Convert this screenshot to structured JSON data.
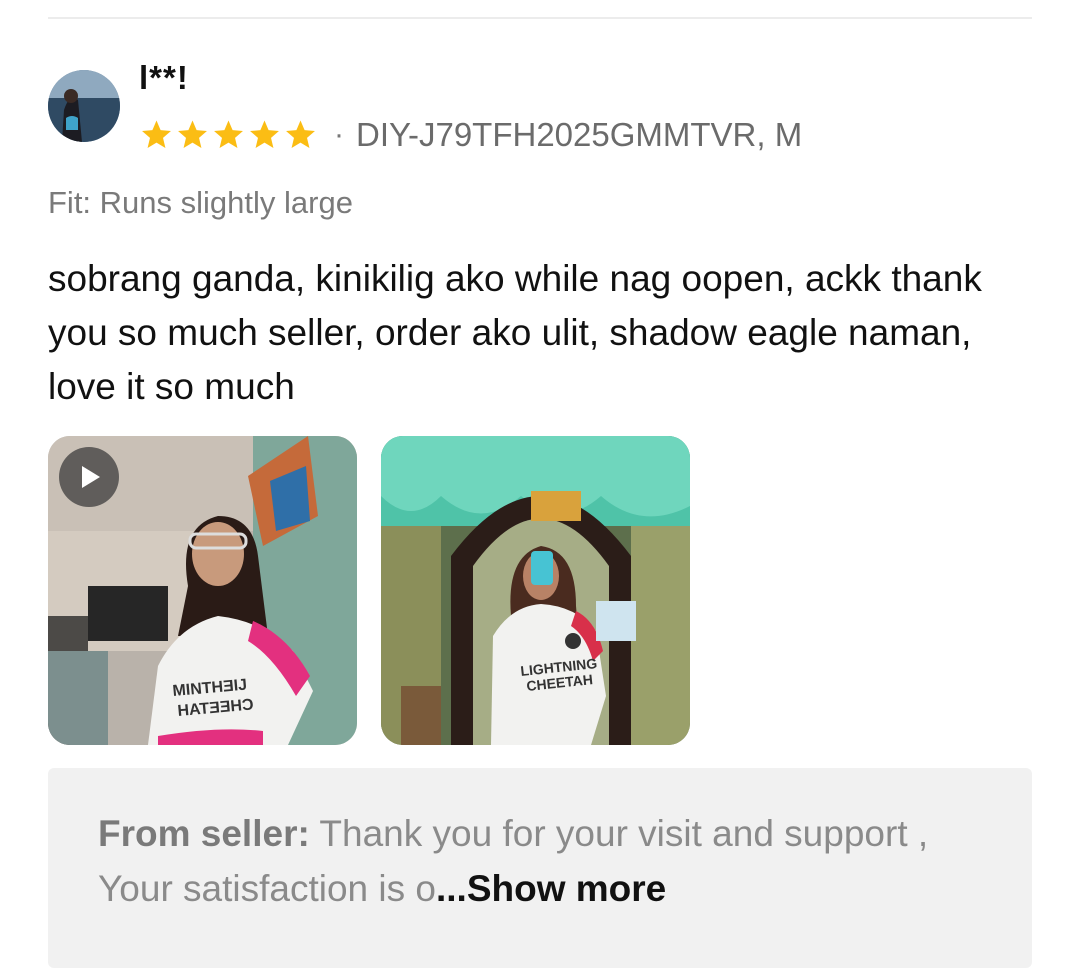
{
  "review": {
    "username": "l**!",
    "rating": 5,
    "rating_max": 5,
    "star_color": "#fbbd14",
    "separator": "·",
    "variant": "DIY-J79TFH2025GMMTVR, M",
    "fit": "Fit: Runs slightly large",
    "text": "sobrang ganda, kinikilig ako while nag oopen, ackk thank you so much seller, order ako ulit, shadow eagle naman, love it so much",
    "media": [
      {
        "type": "video",
        "icon": "play-icon",
        "jersey_text": "LIGHTNING CHEETAH"
      },
      {
        "type": "photo",
        "jersey_text": "LIGHTNING CHEETAH"
      }
    ]
  },
  "seller_reply": {
    "label": "From seller:",
    "text": " Thank you for your visit and support ,    Your satisfaction is o",
    "ellipsis": "...",
    "show_more": "Show more"
  }
}
